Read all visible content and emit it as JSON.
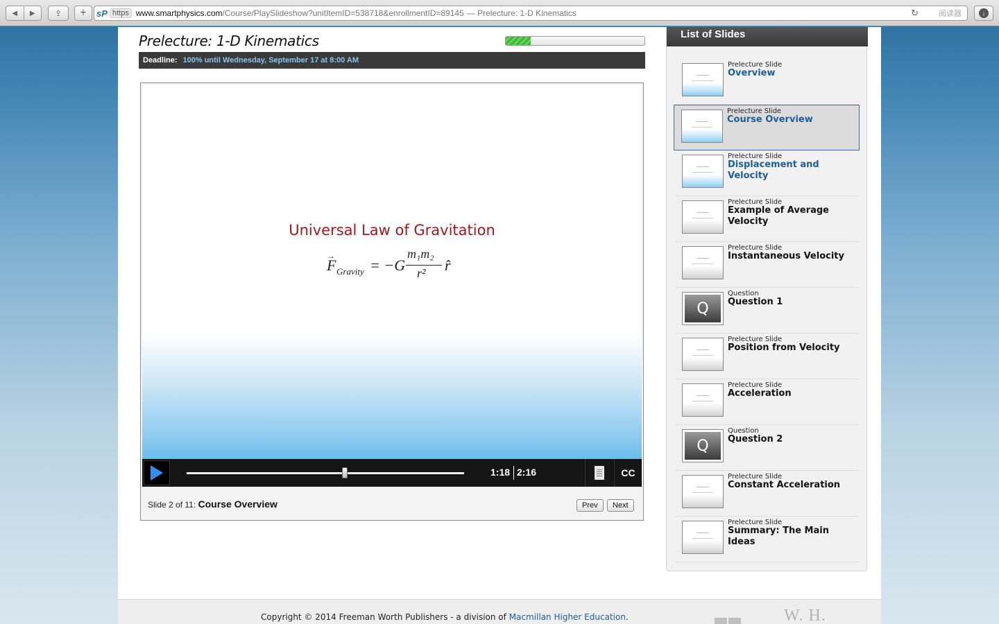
{
  "browser": {
    "https_label": "https",
    "favicon": "sP",
    "url_domain": "www.smartphysics.com",
    "url_path": "/Course/PlaySlideshow?unitItemID=538718&enrollmentID=89145",
    "url_page_title": "— Prelecture: 1-D Kinematics",
    "reader_label": "阅读器"
  },
  "lecture": {
    "title": "Prelecture: 1-D Kinematics",
    "progress_fraction": 0.18,
    "deadline_label": "Deadline:",
    "deadline_text": "100% until Wednesday, September 17 at 8:00 AM"
  },
  "slide": {
    "heading": "Universal Law of Gravitation",
    "formula_symbol_F": "F",
    "formula_sub": "Gravity",
    "formula_eq": "= −G",
    "formula_num": "m₁m₂",
    "formula_den": "r²",
    "formula_unit": "r̂"
  },
  "player": {
    "time_current": "1:18",
    "time_total": "2:16",
    "position_fraction": 0.57,
    "cc_label": "CC"
  },
  "caption": {
    "prefix": "Slide 2 of 11:",
    "title": "Course Overview"
  },
  "nav": {
    "prev": "Prev",
    "next": "Next"
  },
  "list": {
    "header": "List of Slides",
    "items": [
      {
        "type": "Prelecture Slide",
        "title": "Overview",
        "link": true
      },
      {
        "type": "Prelecture Slide",
        "title": "Course Overview",
        "link": true,
        "selected": true
      },
      {
        "type": "Prelecture Slide",
        "title": "Displacement and Velocity",
        "link": true
      },
      {
        "type": "Prelecture Slide",
        "title": "Example of Average Velocity"
      },
      {
        "type": "Prelecture Slide",
        "title": "Instantaneous Velocity"
      },
      {
        "type": "Question",
        "title": "Question 1",
        "question": true
      },
      {
        "type": "Prelecture Slide",
        "title": "Position from Velocity"
      },
      {
        "type": "Prelecture Slide",
        "title": "Acceleration"
      },
      {
        "type": "Question",
        "title": "Question 2",
        "question": true
      },
      {
        "type": "Prelecture Slide",
        "title": "Constant Acceleration"
      },
      {
        "type": "Prelecture Slide",
        "title": "Summary: The Main Ideas"
      }
    ]
  },
  "footer": {
    "copyright_prefix": "Copyright © 2014 Freeman Worth Publishers - a division of ",
    "copyright_link": "Macmillan Higher Education",
    "copyright_suffix": ".",
    "logo_text": "W. H."
  },
  "colors": {
    "accent_link": "#1c5f9a",
    "slide_heading": "#a4181c",
    "play_button": "#2f8ef0",
    "progress_green": "#3db83a"
  }
}
